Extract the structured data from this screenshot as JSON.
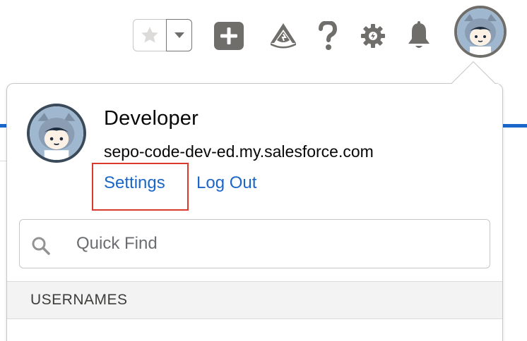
{
  "header": {
    "favorites_icon": "star-icon",
    "favorites_menu_icon": "chevron-down-icon",
    "new_icon": "plus-icon",
    "trailhead_icon": "trailhead-icon",
    "help_icon": "question-icon",
    "setup_icon": "gear-icon",
    "notifications_icon": "bell-icon",
    "avatar_icon": "astro-avatar-icon"
  },
  "profile": {
    "name": "Developer",
    "domain": "sepo-code-dev-ed.my.salesforce.com",
    "settings_label": "Settings",
    "logout_label": "Log Out"
  },
  "search": {
    "placeholder": "Quick Find",
    "value": ""
  },
  "section": {
    "usernames_label": "USERNAMES"
  },
  "colors": {
    "link": "#1b66c9",
    "highlight_border": "#d93a2b",
    "icon_gray": "#706e6b",
    "brand_blue": "#1b66c9"
  }
}
